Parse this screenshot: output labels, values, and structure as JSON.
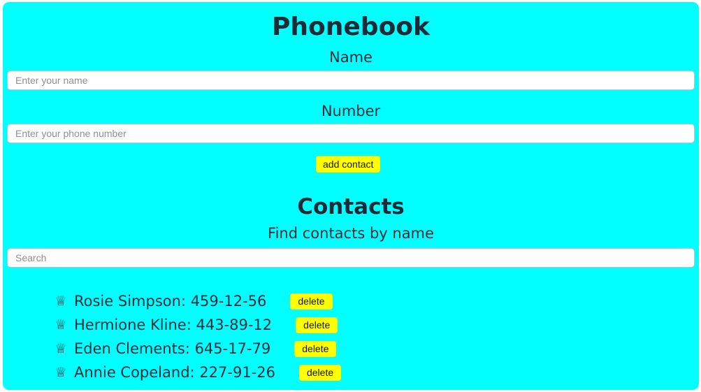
{
  "app": {
    "title": "Phonebook"
  },
  "form": {
    "name_label": "Name",
    "name_placeholder": "Enter your name",
    "name_value": "",
    "number_label": "Number",
    "number_placeholder": "Enter your phone number",
    "number_value": "",
    "add_button_label": "add contact"
  },
  "contacts": {
    "title": "Contacts",
    "filter_label": "Find contacts by name",
    "search_placeholder": "Search",
    "search_value": "",
    "delete_label": "delete",
    "items": [
      {
        "name": "Rosie Simpson",
        "number": "459-12-56",
        "icon": "crown-icon"
      },
      {
        "name": "Hermione Kline",
        "number": "443-89-12",
        "icon": "crown-icon"
      },
      {
        "name": "Eden Clements",
        "number": "645-17-79",
        "icon": "crown-icon"
      },
      {
        "name": "Annie Copeland",
        "number": "227-91-26",
        "icon": "crown-icon"
      }
    ]
  },
  "colors": {
    "background": "#00ffff",
    "button": "#ffff00",
    "text": "#1e2a36"
  }
}
